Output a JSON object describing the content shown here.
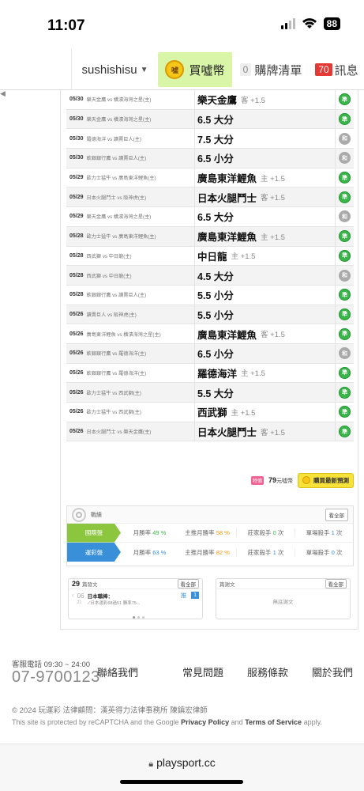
{
  "status": {
    "time": "11:07",
    "battery": "88"
  },
  "nav": {
    "user": "sushishisu",
    "buy": "買噓幣",
    "coin_label": "噓",
    "cart": "購牌清單",
    "cart_count": "0",
    "msg": "訊息",
    "msg_count": "70"
  },
  "rows": [
    {
      "date": "05/30",
      "teams": "樂天金鷹 vs 橫濱海灣之星(主)",
      "pick": "樂天金鷹",
      "sub": "客 +1.5",
      "res": "準"
    },
    {
      "date": "05/30",
      "teams": "樂天金鷹 vs 橫濱海灣之星(主)",
      "pick": "6.5 大分",
      "sub": "",
      "res": "準"
    },
    {
      "date": "05/30",
      "teams": "羅德海洋 vs 讀賣巨人(主)",
      "pick": "7.5 大分",
      "sub": "",
      "res": "和"
    },
    {
      "date": "05/30",
      "teams": "軟銀銀行鷹 vs 讀賣巨人(主)",
      "pick": "6.5 小分",
      "sub": "",
      "res": "和"
    },
    {
      "date": "05/29",
      "teams": "歐力士猛牛 vs 廣島東洋鯉魚(主)",
      "pick": "廣島東洋鯉魚",
      "sub": "主 +1.5",
      "res": "準"
    },
    {
      "date": "05/29",
      "teams": "日本火腿鬥士 vs 阪神虎(主)",
      "pick": "日本火腿鬥士",
      "sub": "客 +1.5",
      "res": "準"
    },
    {
      "date": "05/29",
      "teams": "樂天金鷹 vs 橫濱海灣之星(主)",
      "pick": "6.5 大分",
      "sub": "",
      "res": "和"
    },
    {
      "date": "05/28",
      "teams": "歐力士猛牛 vs 廣島東洋鯉魚(主)",
      "pick": "廣島東洋鯉魚",
      "sub": "主 +1.5",
      "res": "準"
    },
    {
      "date": "05/28",
      "teams": "西武獅 vs 中日龍(主)",
      "pick": "中日龍",
      "sub": "主 +1.5",
      "res": "準"
    },
    {
      "date": "05/28",
      "teams": "西武獅 vs 中日龍(主)",
      "pick": "4.5 大分",
      "sub": "",
      "res": "和"
    },
    {
      "date": "05/28",
      "teams": "軟銀銀行鷹 vs 讀賣巨人(主)",
      "pick": "5.5 小分",
      "sub": "",
      "res": "準"
    },
    {
      "date": "05/26",
      "teams": "讀賣巨人 vs 阪神虎(主)",
      "pick": "5.5 小分",
      "sub": "",
      "res": "準"
    },
    {
      "date": "05/26",
      "teams": "廣島東洋鯉魚 vs 橫濱海灣之星(主)",
      "pick": "廣島東洋鯉魚",
      "sub": "客 +1.5",
      "res": "準"
    },
    {
      "date": "05/26",
      "teams": "軟銀銀行鷹 vs 羅德海洋(主)",
      "pick": "6.5 小分",
      "sub": "",
      "res": "和"
    },
    {
      "date": "05/26",
      "teams": "軟銀銀行鷹 vs 羅德海洋(主)",
      "pick": "羅德海洋",
      "sub": "主 +1.5",
      "res": "準"
    },
    {
      "date": "05/26",
      "teams": "歐力士猛牛 vs 西武獅(主)",
      "pick": "5.5 大分",
      "sub": "",
      "res": "準"
    },
    {
      "date": "05/26",
      "teams": "歐力士猛牛 vs 西武獅(主)",
      "pick": "西武獅",
      "sub": "主 +1.5",
      "res": "準"
    },
    {
      "date": "05/26",
      "teams": "日本火腿鬥士 vs 樂天金鷹(主)",
      "pick": "日本火腿鬥士",
      "sub": "客 +1.5",
      "res": "準"
    }
  ],
  "buybar": {
    "tag": "特價",
    "coins": "79",
    "unit": "元噓幣",
    "button": "購買最新預測"
  },
  "record": {
    "title": "戰績",
    "all": "看全部",
    "rows": [
      {
        "label": "國際盤",
        "month_rate": "月勝率",
        "month_val": "49 %",
        "main_rate": "主推月勝率",
        "main_val": "58 %",
        "streak": "莊家殺手",
        "streak_val": "0",
        "streak_unit": "次",
        "single": "單場殺手",
        "single_val": "1",
        "single_unit": "次"
      },
      {
        "label": "運彩盤",
        "month_rate": "月勝率",
        "month_val": "63 %",
        "main_rate": "主推月勝率",
        "main_val": "82 %",
        "streak": "莊家殺手",
        "streak_val": "1",
        "streak_unit": "次",
        "single": "單場殺手",
        "single_val": "0",
        "single_unit": "次"
      }
    ]
  },
  "posts": {
    "count": "29",
    "label": "篇發文",
    "all": "看全部",
    "date_m": "06",
    "date_d": "21",
    "title": "日本職棒：",
    "desc": "日本運彩68過51 勝率75...",
    "tag_s": "推",
    "tag": "1"
  },
  "replies": {
    "label": "篇謝文",
    "all": "看全部",
    "empty": "無底謝文"
  },
  "footer": {
    "svc": "客服電話 09:30 ~ 24:00",
    "phone": "07-9700123",
    "links": [
      "聯絡我們",
      "常見問題",
      "服務條款",
      "關於我們"
    ],
    "copy": "© 2024 玩運彩 法律顧問：漢英得力法律事務所 陳鎮宏律師",
    "recap_a": "This site is protected by reCAPTCHA and the Google ",
    "recap_b": "Privacy Policy",
    "recap_c": " and ",
    "recap_d": "Terms of Service",
    "recap_e": " apply."
  },
  "url": "playsport.cc"
}
